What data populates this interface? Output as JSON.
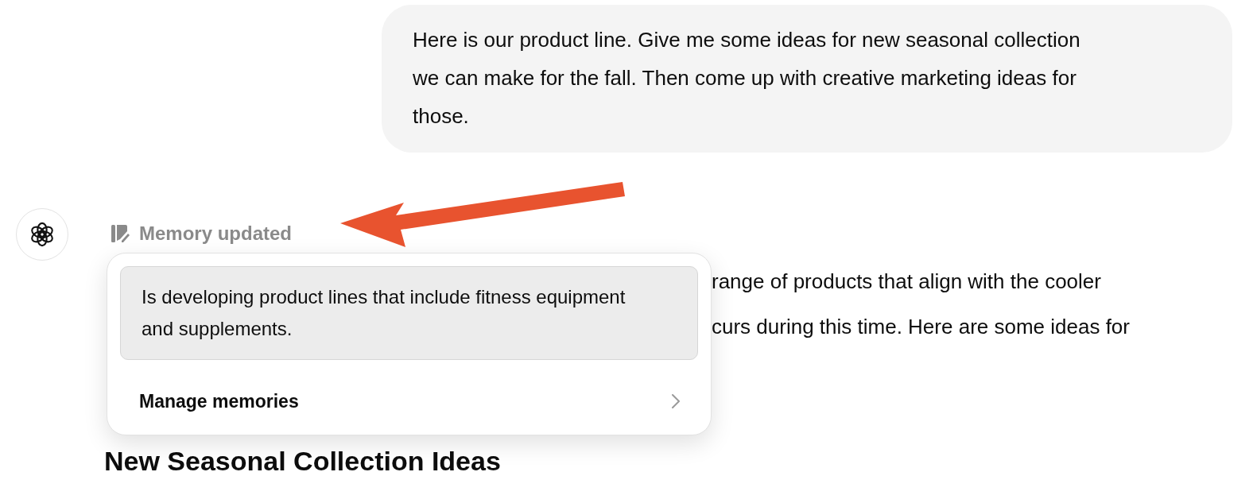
{
  "user_message": {
    "text": "Here is our product line. Give me some ideas for new seasonal collection we can make for the fall. Then come up with creative marketing ideas for those."
  },
  "assistant": {
    "memory_label": "Memory updated",
    "visible_lines": [
      "range of products that align with the cooler",
      "curs during this time. Here are some ideas for"
    ],
    "heading": "New Seasonal Collection Ideas"
  },
  "memory_popup": {
    "memories": [
      "Is developing product lines that include fitness equipment and supplements."
    ],
    "manage_label": "Manage memories"
  }
}
